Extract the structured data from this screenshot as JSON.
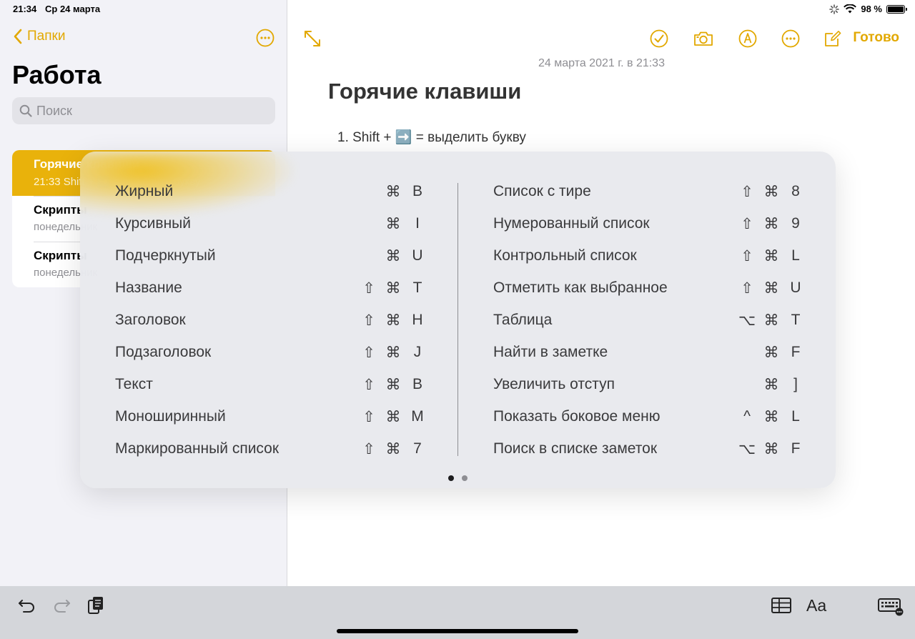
{
  "status": {
    "time": "21:34",
    "date": "Ср 24 марта",
    "battery": "98 %",
    "battery_level": 0.98
  },
  "sidebar": {
    "back_label": "Папки",
    "title": "Работа",
    "search_placeholder": "Поиск",
    "notes": [
      {
        "title": "Горячие клавиши",
        "subtitle": "21:33  Shift + ➡️ = выделить букву",
        "selected": true
      },
      {
        "title": "Скрипты",
        "subtitle": "понедельник",
        "selected": false
      },
      {
        "title": "Скрипты",
        "subtitle": "понедельник",
        "selected": false
      }
    ]
  },
  "editor": {
    "done_label": "Готово",
    "date": "24 марта 2021 г. в 21:33",
    "heading": "Горячие клавиши",
    "line1": "1.  Shift + ➡️ = выделить букву"
  },
  "shortcuts": {
    "left": [
      {
        "label": "Жирный",
        "keys": [
          "⌘",
          "B"
        ]
      },
      {
        "label": "Курсивный",
        "keys": [
          "⌘",
          "I"
        ]
      },
      {
        "label": "Подчеркнутый",
        "keys": [
          "⌘",
          "U"
        ]
      },
      {
        "label": "Название",
        "keys": [
          "⇧",
          "⌘",
          "T"
        ]
      },
      {
        "label": "Заголовок",
        "keys": [
          "⇧",
          "⌘",
          "H"
        ]
      },
      {
        "label": "Подзаголовок",
        "keys": [
          "⇧",
          "⌘",
          "J"
        ]
      },
      {
        "label": "Текст",
        "keys": [
          "⇧",
          "⌘",
          "B"
        ]
      },
      {
        "label": "Моноширинный",
        "keys": [
          "⇧",
          "⌘",
          "M"
        ]
      },
      {
        "label": "Маркированный список",
        "keys": [
          "⇧",
          "⌘",
          "7"
        ]
      }
    ],
    "right": [
      {
        "label": "Список с тире",
        "keys": [
          "⇧",
          "⌘",
          "8"
        ]
      },
      {
        "label": "Нумерованный список",
        "keys": [
          "⇧",
          "⌘",
          "9"
        ]
      },
      {
        "label": "Контрольный список",
        "keys": [
          "⇧",
          "⌘",
          "L"
        ]
      },
      {
        "label": "Отметить как выбранное",
        "keys": [
          "⇧",
          "⌘",
          "U"
        ]
      },
      {
        "label": "Таблица",
        "keys": [
          "⌥",
          "⌘",
          "T"
        ]
      },
      {
        "label": "Найти в заметке",
        "keys": [
          "⌘",
          "F"
        ]
      },
      {
        "label": "Увеличить отступ",
        "keys": [
          "⌘",
          "]"
        ]
      },
      {
        "label": "Показать боковое меню",
        "keys": [
          "^",
          "⌘",
          "L"
        ]
      },
      {
        "label": "Поиск в списке заметок",
        "keys": [
          "⌥",
          "⌘",
          "F"
        ]
      }
    ],
    "pages": 2,
    "current_page": 1
  },
  "bottom_bar": {
    "format_label": "Aa"
  },
  "colors": {
    "accent": "#e2a800",
    "selected_note": "#e9b20b"
  }
}
